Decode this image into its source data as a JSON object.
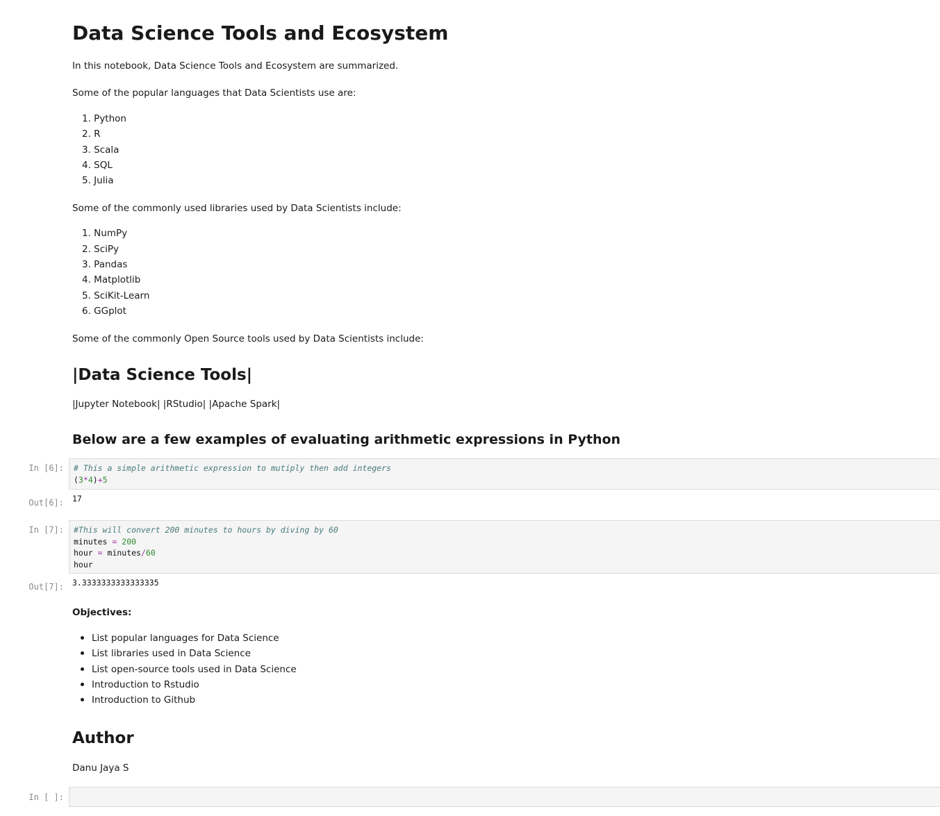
{
  "title": "Data Science Tools and Ecosystem",
  "intro": "In this notebook, Data Science Tools and Ecosystem are summarized.",
  "languages": {
    "heading": "Some of the popular languages that Data Scientists use are:",
    "items": [
      "1. Python",
      "2. R",
      "3. Scala",
      "4. SQL",
      "5. Julia"
    ]
  },
  "libraries": {
    "heading": "Some of the commonly used libraries used by Data Scientists include:",
    "items": [
      "1. NumPy",
      "2. SciPy",
      "3. Pandas",
      "4. Matplotlib",
      "5. SciKit-Learn",
      "6. GGplot"
    ]
  },
  "tools": {
    "heading": "Some of the commonly Open Source tools used by Data Scientists include:",
    "table_header": "|Data Science Tools|",
    "table_row": "|Jupyter Notebook| |RStudio| |Apache Spark|"
  },
  "arith_heading": "Below are a few examples of evaluating arithmetic expressions in Python",
  "cells": [
    {
      "in_prompt": "In [6]:",
      "out_prompt": "Out[6]:",
      "comment": "# This a simple arithmetic expression to mutiply then add integers",
      "code_open": "(",
      "n1": "3",
      "op1": "*",
      "n2": "4",
      "code_close": ")",
      "op2": "+",
      "n3": "5",
      "output": "17"
    },
    {
      "in_prompt": "In [7]:",
      "out_prompt": "Out[7]:",
      "comment": "#This will convert 200 minutes to hours by diving by 60",
      "l2_var": "minutes",
      "l2_op": "=",
      "l2_num": "200",
      "l3_var": "hour",
      "l3_op": "=",
      "l3_expr": "minutes",
      "l3_div": "/",
      "l3_num": "60",
      "l4_var": "hour",
      "output": "3.3333333333333335"
    }
  ],
  "objectives": {
    "heading": "Objectives:",
    "items": [
      "List popular languages for Data Science",
      "List libraries used in Data Science",
      "List open-source tools used in Data Science",
      "Introduction to Rstudio",
      "Introduction to Github"
    ]
  },
  "author": {
    "heading": "Author",
    "name": "Danu Jaya S"
  },
  "empty_cell_prompt": "In [ ]:"
}
